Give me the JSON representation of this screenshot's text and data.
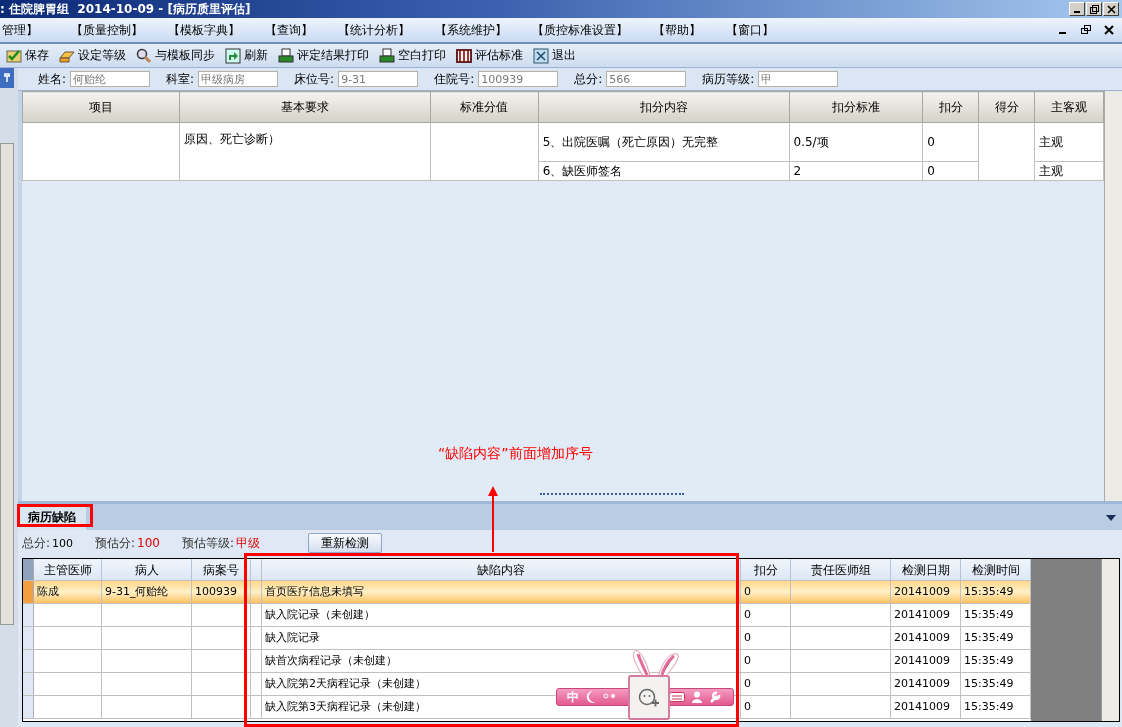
{
  "window": {
    "title": ": 住院脾胃组  2014-10-09 - [病历质里评估]"
  },
  "menu": [
    "管理】",
    "【质量控制】",
    "【模板字典】",
    "【查询】",
    "【统计分析】",
    "【系统维护】",
    "【质控标准设置】",
    "【帮助】",
    "【窗口】"
  ],
  "toolbar": [
    "保存",
    "设定等级",
    "与模板同步",
    "刷新",
    "评定结果打印",
    "空白打印",
    "评估标准",
    "退出"
  ],
  "info_fields": [
    {
      "label": "姓名:",
      "value": "何贻纶"
    },
    {
      "label": "科室:",
      "value": "甲级病房"
    },
    {
      "label": "床位号:",
      "value": "9-31"
    },
    {
      "label": "住院号:",
      "value": "100939"
    },
    {
      "label": "总分:",
      "value": "566"
    },
    {
      "label": "病历等级:",
      "value": "甲"
    }
  ],
  "quality_table": {
    "columns": [
      "项目",
      "基本要求",
      "标准分值",
      "扣分内容",
      "扣分标准",
      "扣分",
      "得分",
      "主客观"
    ],
    "basic_requirement": "原因、死亡诊断）",
    "rows": [
      {
        "content": "5、出院医嘱（死亡原因）无完整",
        "standard": "0.5/项",
        "deduction": "0",
        "type": "主观"
      },
      {
        "content": "6、缺医师签名",
        "standard": "2",
        "deduction": "0",
        "type": "主观"
      }
    ]
  },
  "annotation": {
    "text": "“缺陷内容”前面增加序号"
  },
  "defect_panel": {
    "tab": "病历缺陷",
    "total_label": "总分:",
    "total": "100",
    "estimate_label": "预估分:",
    "estimate": "100",
    "grade_label": "预估等级:",
    "grade": "甲级",
    "recheck_button": "重新检测",
    "columns": [
      "主管医师",
      "病人",
      "病案号",
      "缺陷内容",
      "扣分",
      "责任医师组",
      "检测日期",
      "检测时间"
    ],
    "rows": [
      {
        "selected": true,
        "cells": [
          "陈成",
          "9-31_何贻纶",
          "100939",
          "首页医疗信息未填写",
          "0",
          "",
          "20141009",
          "15:35:49"
        ]
      },
      {
        "selected": false,
        "cells": [
          "",
          "",
          "",
          "缺入院记录（未创建）",
          "0",
          "",
          "20141009",
          "15:35:49"
        ]
      },
      {
        "selected": false,
        "cells": [
          "",
          "",
          "",
          "缺入院记录",
          "0",
          "",
          "20141009",
          "15:35:49"
        ]
      },
      {
        "selected": false,
        "cells": [
          "",
          "",
          "",
          "缺首次病程记录（未创建）",
          "0",
          "",
          "20141009",
          "15:35:49"
        ]
      },
      {
        "selected": false,
        "cells": [
          "",
          "",
          "",
          "缺入院第2天病程记录（未创建）",
          "0",
          "",
          "20141009",
          "15:35:49"
        ]
      },
      {
        "selected": false,
        "cells": [
          "",
          "",
          "",
          "缺入院第3天病程记录（未创建）",
          "0",
          "",
          "20141009",
          "15:35:49"
        ]
      }
    ]
  },
  "ime_bar": {
    "label": "中"
  }
}
